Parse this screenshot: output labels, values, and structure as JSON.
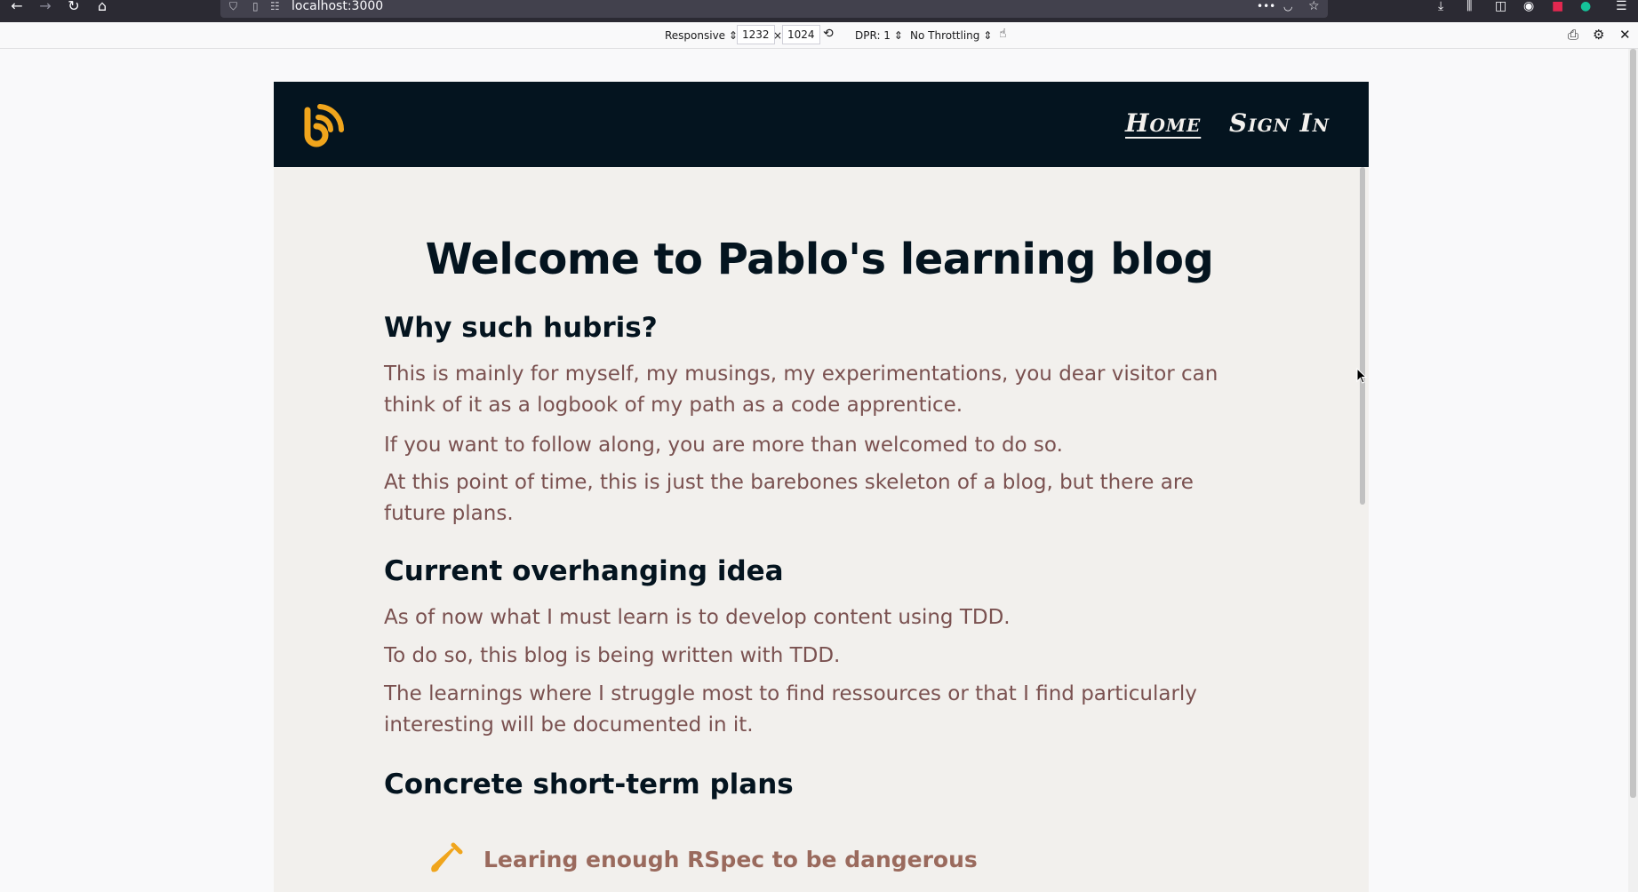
{
  "browser": {
    "url": "localhost:3000",
    "back_icon": "←",
    "forward_icon": "→",
    "reload_icon": "↻",
    "home_icon": "⌂",
    "more_icon": "•••"
  },
  "rdm": {
    "device": "Responsive ⇕",
    "width": "1232",
    "times": "×",
    "height": "1024",
    "dpr": "DPR: 1 ⇕",
    "throttling": "No Throttling ⇕"
  },
  "site": {
    "nav": {
      "home": "Home",
      "sign_in": "Sign In"
    },
    "title": "Welcome to Pablo's learning blog",
    "sections": [
      {
        "heading": "Why such hubris?",
        "paragraphs": [
          "This is mainly for myself, my musings, my experimentations, you dear visitor can think of it as a logbook of my path as a code apprentice.",
          "If you want to follow along, you are more than welcomed to do so.",
          "At this point of time, this is just the barebones skeleton of a blog, but there are future plans."
        ]
      },
      {
        "heading": "Current overhanging idea",
        "paragraphs": [
          "As of now what I must learn is to develop content using TDD.",
          "To do so, this blog is being written with TDD.",
          "The learnings where I struggle most to find ressources or that I find particularly interesting will be documented in it."
        ]
      },
      {
        "heading": "Concrete short-term plans",
        "items": [
          "Learing enough RSpec to be dangerous"
        ]
      }
    ]
  },
  "colors": {
    "header_bg": "#04141f",
    "accent": "#f0a51c",
    "body_bg": "#f2f0ed",
    "heading": "#04141f",
    "paragraph": "#7a5150"
  }
}
